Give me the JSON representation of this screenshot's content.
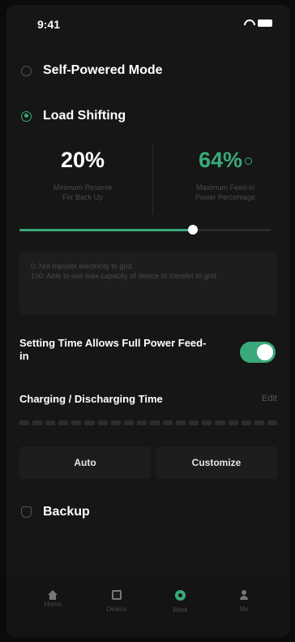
{
  "status_bar": {
    "time": "9:41"
  },
  "modes": {
    "self_powered": {
      "label": "Self-Powered Mode"
    },
    "load_shifting": {
      "label": "Load Shifting"
    },
    "backup": {
      "label": "Backup"
    }
  },
  "load_shifting": {
    "min_reserve": {
      "value": "20%",
      "label_line1": "Minimum Reserve",
      "label_line2": "For Back Up"
    },
    "max_feed": {
      "value": "64%",
      "label_line1": "Maximum Feed-in",
      "label_line2": "Power Percentage"
    },
    "slider_fraction": 0.69,
    "note_line1": "0: Not transfer electricity to grid.",
    "note_line2": "100: Able to use max capacity of device to transfer to grid."
  },
  "full_power_setting": {
    "label": "Setting Time Allows Full Power Feed-in",
    "enabled": true
  },
  "charging": {
    "label": "Charging / Discharging Time",
    "edit": "Edit"
  },
  "choices": {
    "auto": "Auto",
    "customize": "Customize"
  },
  "tabbar": {
    "home": "Home",
    "device": "Device",
    "work": "Work",
    "me": "Me"
  },
  "colors": {
    "accent": "#3aa97a",
    "background": "#161616"
  }
}
